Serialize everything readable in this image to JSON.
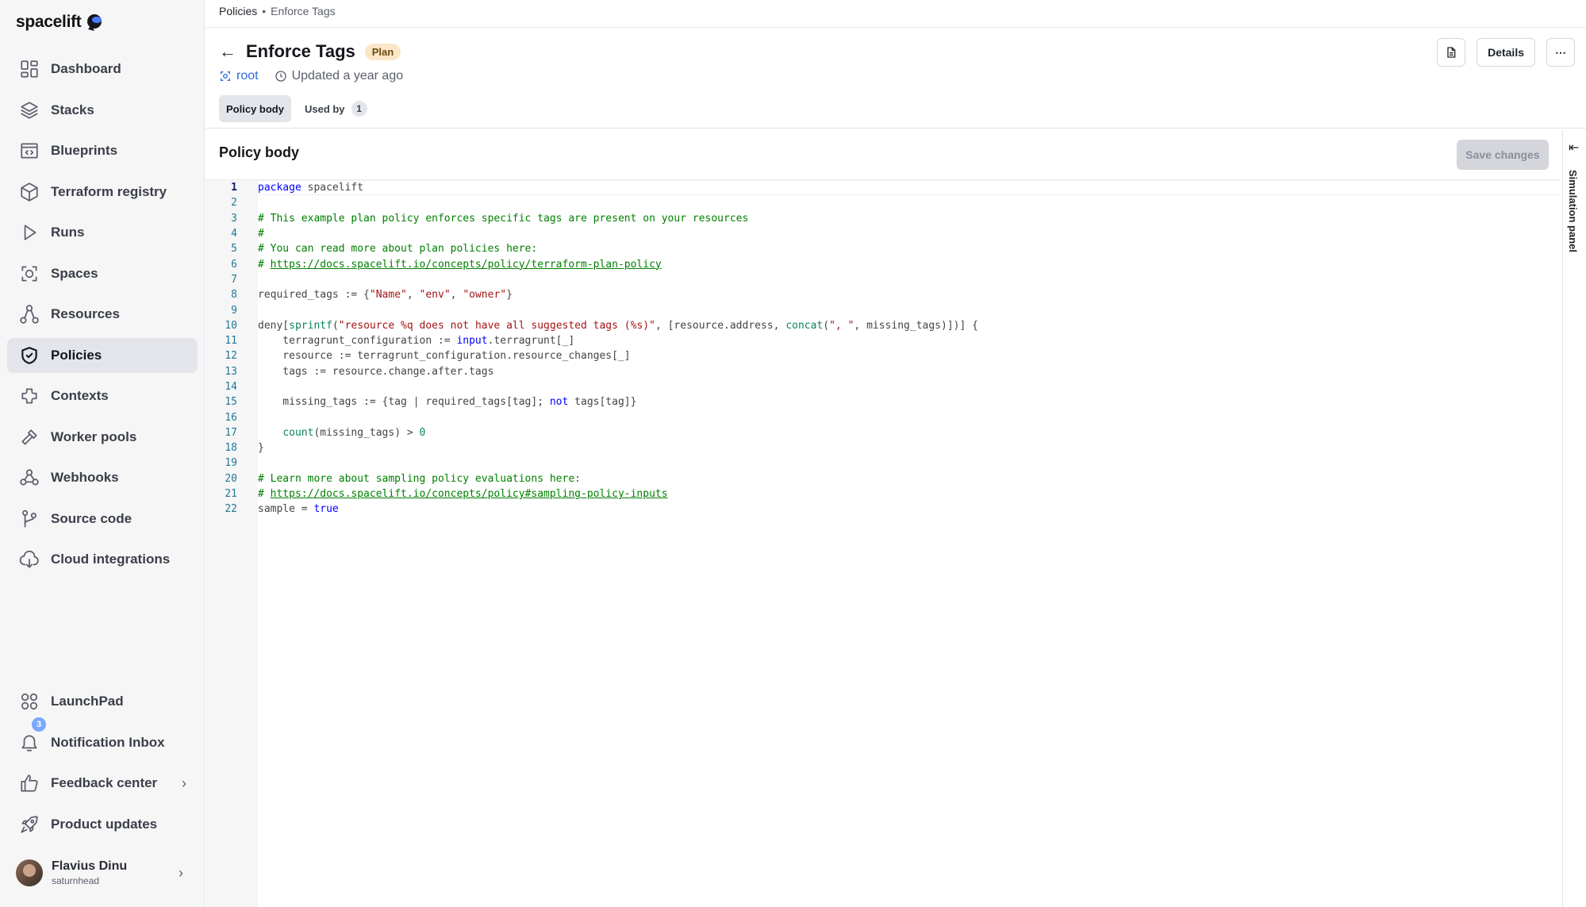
{
  "app": {
    "logo_text": "spacelift"
  },
  "sidebar": {
    "items": [
      {
        "label": "Dashboard",
        "icon": "dashboard-icon"
      },
      {
        "label": "Stacks",
        "icon": "stacks-icon"
      },
      {
        "label": "Blueprints",
        "icon": "blueprints-icon"
      },
      {
        "label": "Terraform registry",
        "icon": "terraform-registry-icon"
      },
      {
        "label": "Runs",
        "icon": "runs-icon"
      },
      {
        "label": "Spaces",
        "icon": "spaces-icon"
      },
      {
        "label": "Resources",
        "icon": "resources-icon"
      },
      {
        "label": "Policies",
        "icon": "policies-icon",
        "active": true
      },
      {
        "label": "Contexts",
        "icon": "contexts-icon"
      },
      {
        "label": "Worker pools",
        "icon": "worker-pools-icon"
      },
      {
        "label": "Webhooks",
        "icon": "webhooks-icon"
      },
      {
        "label": "Source code",
        "icon": "source-code-icon"
      },
      {
        "label": "Cloud integrations",
        "icon": "cloud-integrations-icon"
      }
    ],
    "bottom": [
      {
        "label": "LaunchPad",
        "icon": "launchpad-icon"
      },
      {
        "label": "Notification Inbox",
        "icon": "bell-icon",
        "badge": "3"
      },
      {
        "label": "Feedback center",
        "icon": "thumbs-up-icon",
        "chevron": true
      },
      {
        "label": "Product updates",
        "icon": "rocket-icon"
      }
    ],
    "user": {
      "name": "Flavius Dinu",
      "org": "saturnhead"
    }
  },
  "breadcrumb": {
    "root": "Policies",
    "separator": "•",
    "current": "Enforce Tags"
  },
  "header": {
    "title": "Enforce Tags",
    "badge": "Plan",
    "space": "root",
    "updated": "Updated a year ago",
    "details_label": "Details",
    "more_label": "⋯"
  },
  "tabs": [
    {
      "label": "Policy body",
      "active": true
    },
    {
      "label": "Used by",
      "count": "1"
    }
  ],
  "section": {
    "title": "Policy body",
    "save_label": "Save changes"
  },
  "simulation": {
    "label": "Simulation panel"
  },
  "code_lines": [
    "package spacelift",
    "",
    "# This example plan policy enforces specific tags are present on your resources",
    "#",
    "# You can read more about plan policies here:",
    "# https://docs.spacelift.io/concepts/policy/terraform-plan-policy",
    "",
    "required_tags := {\"Name\", \"env\", \"owner\"}",
    "",
    "deny[sprintf(\"resource %q does not have all suggested tags (%s)\", [resource.address, concat(\", \", missing_tags)])] {",
    "    terragrunt_configuration := input.terragrunt[_]",
    "    resource := terragrunt_configuration.resource_changes[_]",
    "    tags := resource.change.after.tags",
    "",
    "    missing_tags := {tag | required_tags[tag]; not tags[tag]}",
    "",
    "    count(missing_tags) > 0",
    "}",
    "",
    "# Learn more about sampling policy evaluations here:",
    "# https://docs.spacelift.io/concepts/policy#sampling-policy-inputs",
    "sample = true"
  ]
}
